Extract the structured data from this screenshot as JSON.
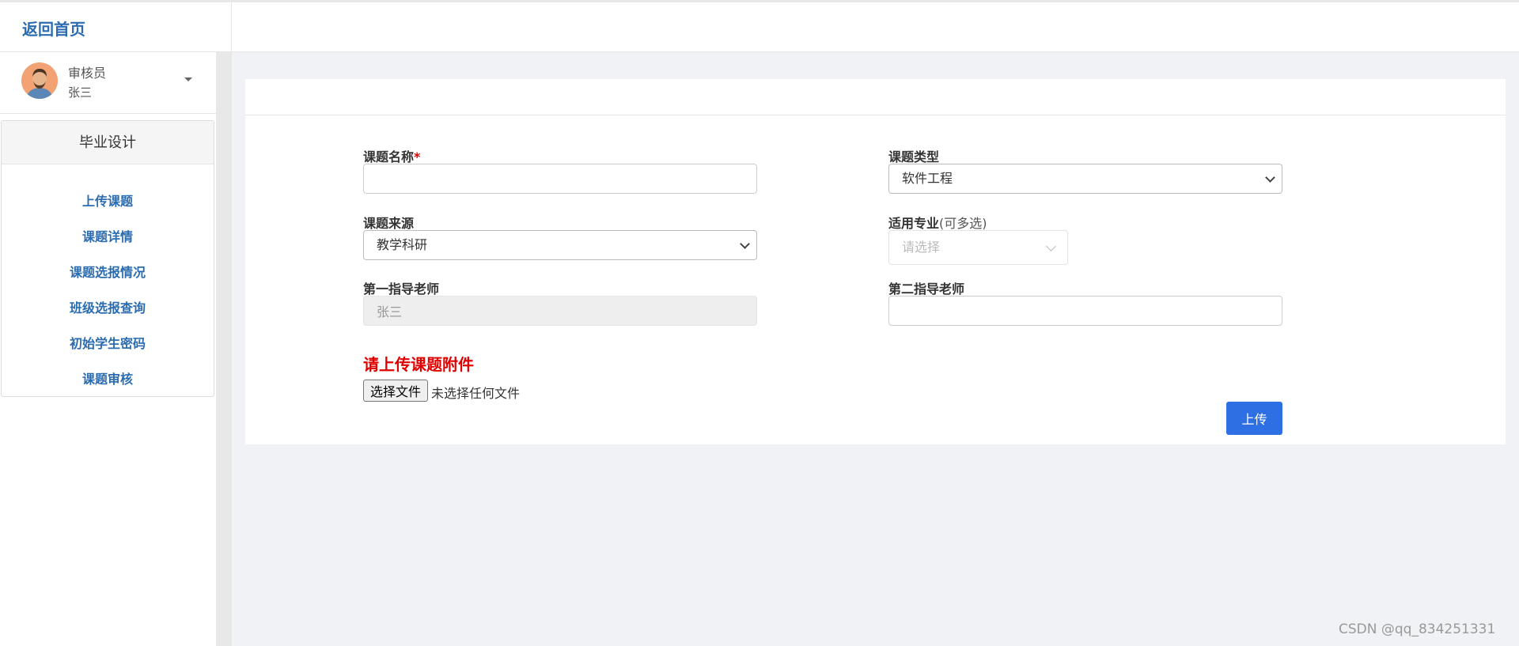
{
  "header": {
    "home_link": "返回首页"
  },
  "user": {
    "role": "审核员",
    "name": "张三"
  },
  "sidebar": {
    "section_title": "毕业设计",
    "items": [
      {
        "label": "上传课题"
      },
      {
        "label": "课题详情"
      },
      {
        "label": "课题选报情况"
      },
      {
        "label": "班级选报查询"
      },
      {
        "label": "初始学生密码"
      },
      {
        "label": "课题审核"
      }
    ]
  },
  "form": {
    "topic_name": {
      "label": "课题名称",
      "required_mark": "*",
      "value": ""
    },
    "topic_type": {
      "label": "课题类型",
      "selected": "软件工程"
    },
    "topic_source": {
      "label": "课题来源",
      "selected": "教学科研"
    },
    "majors": {
      "label": "适用专业",
      "hint": "(可多选)",
      "placeholder": "请选择"
    },
    "first_advisor": {
      "label": "第一指导老师",
      "value": "张三"
    },
    "second_advisor": {
      "label": "第二指导老师",
      "value": ""
    },
    "upload": {
      "title": "请上传课题附件",
      "choose_button": "选择文件",
      "status": "未选择任何文件",
      "submit_button": "上传"
    }
  },
  "watermark": "CSDN @qq_834251331",
  "colors": {
    "link": "#2b6cb0",
    "primary_button": "#2f6fe4",
    "warning_text": "#e00000"
  }
}
